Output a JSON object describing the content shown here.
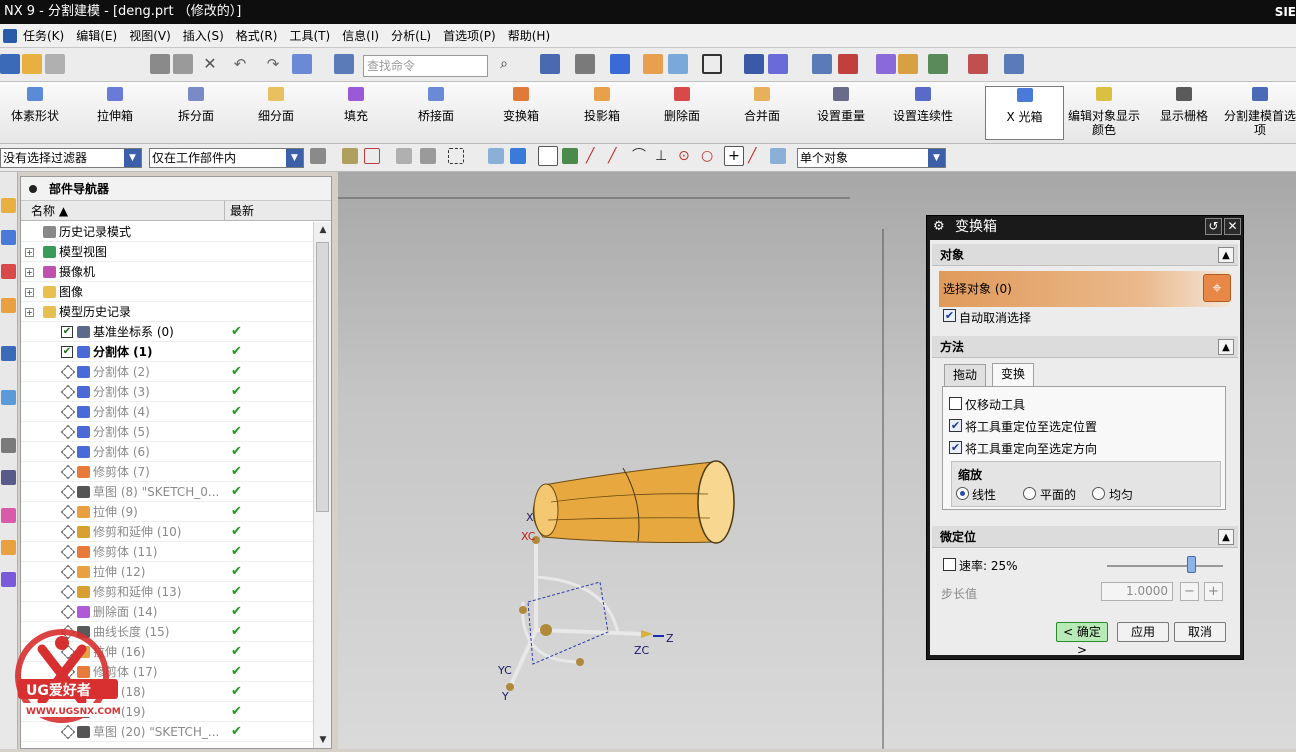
{
  "window": {
    "title": "NX 9 - 分割建模 - [deng.prt （修改的）]",
    "brand_fragment": "SIE"
  },
  "menu": [
    "任务(K)",
    "编辑(E)",
    "视图(V)",
    "插入(S)",
    "格式(R)",
    "工具(T)",
    "信息(I)",
    "分析(L)",
    "首选项(P)",
    "帮助(H)"
  ],
  "toolbar": {
    "search_placeholder": "查找命令"
  },
  "ribbon": [
    {
      "label": "体素形状",
      "icon": "primitive-shape-icon"
    },
    {
      "label": "拉伸箱",
      "icon": "extrude-box-icon"
    },
    {
      "label": "拆分面",
      "icon": "split-face-icon"
    },
    {
      "label": "细分面",
      "icon": "subdivide-face-icon"
    },
    {
      "label": "填充",
      "icon": "fill-icon"
    },
    {
      "label": "桥接面",
      "icon": "bridge-face-icon"
    },
    {
      "label": "变换箱",
      "icon": "transform-cage-icon"
    },
    {
      "label": "投影箱",
      "icon": "project-cage-icon"
    },
    {
      "label": "删除面",
      "icon": "delete-face-icon"
    },
    {
      "label": "合并面",
      "icon": "merge-face-icon"
    },
    {
      "label": "设置重量",
      "icon": "set-weight-icon"
    },
    {
      "label": "设置连续性",
      "icon": "set-continuity-icon"
    },
    {
      "label": "X 光箱",
      "icon": "xray-cage-icon"
    },
    {
      "label": "编辑对象显示颜色",
      "icon": "edit-display-color-icon"
    },
    {
      "label": "显示栅格",
      "icon": "show-grid-icon"
    },
    {
      "label": "分割建模首选项",
      "icon": "subdiv-preferences-icon"
    }
  ],
  "selection_bar": {
    "filter": "没有选择过滤器",
    "scope": "仅在工作部件内",
    "mode": "单个对象"
  },
  "navigator": {
    "title": "部件导航器",
    "columns": [
      "名称",
      "最新"
    ],
    "rows": [
      {
        "label": "历史记录模式",
        "indent": 0,
        "check": "",
        "state": "normal",
        "icon": "clock-icon"
      },
      {
        "label": "模型视图",
        "indent": 0,
        "check": "",
        "state": "normal",
        "icon": "model-views-icon"
      },
      {
        "label": "摄像机",
        "indent": 0,
        "check": "",
        "state": "normal",
        "icon": "camera-icon"
      },
      {
        "label": "图像",
        "indent": 0,
        "check": "",
        "state": "normal",
        "icon": "folder-icon"
      },
      {
        "label": "模型历史记录",
        "indent": 0,
        "check": "",
        "state": "normal",
        "icon": "folder-icon"
      },
      {
        "label": "基准坐标系 (0)",
        "indent": 1,
        "check": "✔",
        "state": "normal",
        "icon": "datum-csys-icon"
      },
      {
        "label": "分割体 (1)",
        "indent": 1,
        "check": "✔",
        "state": "bold",
        "icon": "subdiv-body-icon"
      },
      {
        "label": "分割体 (2)",
        "indent": 1,
        "check": "✔",
        "state": "gray",
        "icon": "subdiv-body-icon"
      },
      {
        "label": "分割体 (3)",
        "indent": 1,
        "check": "✔",
        "state": "gray",
        "icon": "subdiv-body-icon"
      },
      {
        "label": "分割体 (4)",
        "indent": 1,
        "check": "✔",
        "state": "gray",
        "icon": "subdiv-body-icon"
      },
      {
        "label": "分割体 (5)",
        "indent": 1,
        "check": "✔",
        "state": "gray",
        "icon": "subdiv-body-icon"
      },
      {
        "label": "分割体 (6)",
        "indent": 1,
        "check": "✔",
        "state": "gray",
        "icon": "subdiv-body-icon"
      },
      {
        "label": "修剪体 (7)",
        "indent": 1,
        "check": "✔",
        "state": "gray",
        "icon": "trim-body-icon"
      },
      {
        "label": "草图 (8) \"SKETCH_0...",
        "indent": 1,
        "check": "✔",
        "state": "gray",
        "icon": "sketch-icon"
      },
      {
        "label": "拉伸 (9)",
        "indent": 1,
        "check": "✔",
        "state": "gray",
        "icon": "extrude-icon"
      },
      {
        "label": "修剪和延伸 (10)",
        "indent": 1,
        "check": "✔",
        "state": "gray",
        "icon": "trim-extend-icon"
      },
      {
        "label": "修剪体 (11)",
        "indent": 1,
        "check": "✔",
        "state": "gray",
        "icon": "trim-body-icon"
      },
      {
        "label": "拉伸 (12)",
        "indent": 1,
        "check": "✔",
        "state": "gray",
        "icon": "extrude-icon"
      },
      {
        "label": "修剪和延伸 (13)",
        "indent": 1,
        "check": "✔",
        "state": "gray",
        "icon": "trim-extend-icon"
      },
      {
        "label": "删除面 (14)",
        "indent": 1,
        "check": "✔",
        "state": "gray",
        "icon": "delete-face-icon"
      },
      {
        "label": "曲线长度 (15)",
        "indent": 1,
        "check": "✔",
        "state": "gray",
        "icon": "curve-length-icon"
      },
      {
        "label": "拉伸 (16)",
        "indent": 1,
        "check": "✔",
        "state": "gray",
        "icon": "extrude-icon"
      },
      {
        "label": "修剪体 (17)",
        "indent": 1,
        "check": "✔",
        "state": "gray",
        "icon": "trim-body-icon"
      },
      {
        "label": "曲线 (18)",
        "indent": 1,
        "check": "✔",
        "state": "gray",
        "icon": "curve-icon"
      },
      {
        "label": "曲线 (19)",
        "indent": 1,
        "check": "✔",
        "state": "gray",
        "icon": "curve-icon"
      },
      {
        "label": "草图 (20) \"SKETCH_...",
        "indent": 1,
        "check": "✔",
        "state": "gray",
        "icon": "sketch-icon"
      }
    ]
  },
  "viewport": {
    "axis_labels": [
      "X",
      "XC",
      "Z",
      "ZC",
      "YC",
      "Y"
    ]
  },
  "dialog": {
    "title": "变换箱",
    "object_section": "对象",
    "select_object": "选择对象 (0)",
    "auto_deselect": "自动取消选择",
    "method_section": "方法",
    "tabs": [
      "拖动",
      "变换"
    ],
    "move_tool_only": "仅移动工具",
    "reposition_tool": "将工具重定位至选定位置",
    "reorient_tool": "将工具重定向至选定方向",
    "scale_group": "缩放",
    "scale_options": [
      "线性",
      "平面的",
      "均匀"
    ],
    "fine_section": "微定位",
    "rate_label": "速率: 25%",
    "rate_value": 25,
    "step_label": "步长值",
    "step_value": "1.0000",
    "ok": "< 确定 >",
    "apply": "应用",
    "cancel": "取消"
  },
  "watermark": {
    "text": "UG爱好者",
    "url": "WWW.UGSNX.COM"
  },
  "colors": {
    "accent_orange": "#e88846",
    "check_green": "#1a9a1a",
    "model_gold": "#f0b040"
  }
}
